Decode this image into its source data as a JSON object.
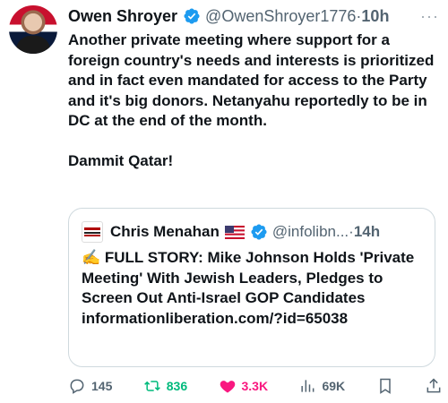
{
  "tweet": {
    "author_name": "Owen Shroyer",
    "handle": "@OwenShroyer1776",
    "dot": "·",
    "time": "10h",
    "more": "···",
    "text": "Another private meeting where support for a foreign country's needs and interests is prioritized and in fact even mandated for access to the Party and it's big donors. Netanyahu reportedly to be in DC at the end of the month.\n\nDammit Qatar!"
  },
  "quote": {
    "avatar_label": "INFORMATION LIBERATION",
    "author_name": "Chris Menahan",
    "handle": "@infolibn...",
    "dot": "·",
    "time": "14h",
    "text": "✍️ FULL STORY: Mike Johnson Holds 'Private Meeting' With Jewish Leaders, Pledges to Screen Out Anti-Israel GOP Candidates informationliberation.com/?id=65038"
  },
  "actions": {
    "replies": "145",
    "reposts": "836",
    "likes": "3.3K",
    "views": "69K"
  },
  "colors": {
    "verified": "#1d9bf0",
    "repost": "#00ba7c",
    "like": "#f91880",
    "secondary_text": "#536471"
  },
  "icons": [
    "verified-icon",
    "us-flag-icon",
    "reply-icon",
    "repost-icon",
    "like-icon",
    "views-icon",
    "bookmark-icon",
    "share-icon"
  ]
}
